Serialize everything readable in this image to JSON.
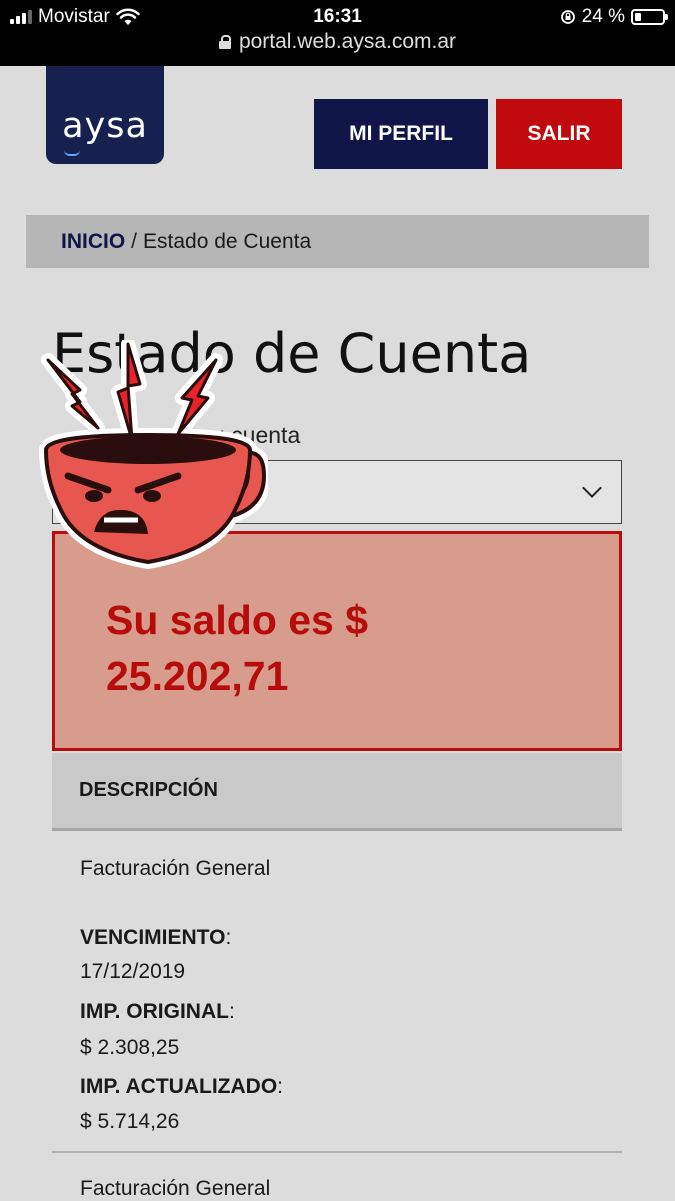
{
  "status_bar": {
    "carrier": "Movistar",
    "time": "16:31",
    "battery_text": "24 %",
    "battery_level": 0.24,
    "url": "portal.web.aysa.com.ar"
  },
  "header": {
    "logo_text": "aysa",
    "profile_button": "MI PERFIL",
    "logout_button": "SALIR"
  },
  "breadcrumb": {
    "home": "INICIO",
    "separator": "/",
    "current": "Estado de Cuenta"
  },
  "page_title": "Estado de Cuenta",
  "account_select": {
    "label_visible": "u cuenta",
    "selected_value": ""
  },
  "balance": {
    "line1": "Su saldo es $",
    "line2": "25.202,71"
  },
  "table": {
    "header": "DESCRIPCIÓN",
    "items": [
      {
        "description": "Facturación General",
        "due_label": "VENCIMIENTO",
        "due_value": "17/12/2019",
        "original_label": "IMP. ORIGINAL",
        "original_value": "$ 2.308,25",
        "updated_label": "IMP. ACTUALIZADO",
        "updated_value": "$ 5.714,26"
      },
      {
        "description": "Facturación General"
      }
    ]
  },
  "colors": {
    "brand_navy": "#0f1547",
    "brand_red": "#c10a0e",
    "balance_bg": "#d89c8c",
    "sticker_red": "#e8574f"
  },
  "sticker": {
    "icon": "angry-coffee-cup-sticker"
  }
}
